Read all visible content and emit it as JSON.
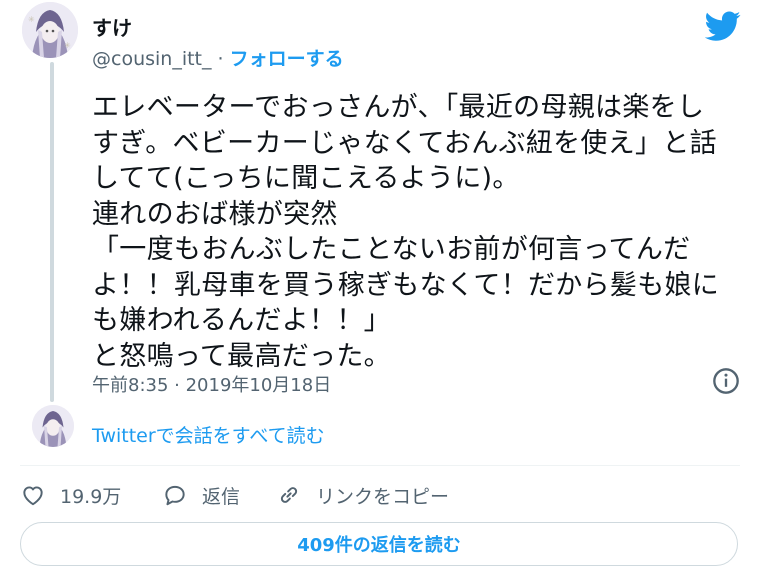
{
  "author": {
    "display_name": "すけ",
    "handle": "@cousin_itt_",
    "separator": " · ",
    "follow_label": "フォローする"
  },
  "tweet": {
    "lines": [
      "エレベーターでおっさんが、「最近の母親は楽をし",
      "すぎ。ベビーカーじゃなくておんぶ紐を使え」と話",
      "してて(こっちに聞こえるように)。",
      "連れのおば様が突然",
      "「一度もおんぶしたことないお前が何言ってんだ",
      "よ！！乳母車を買う稼ぎもなくて！だから髪も娘に",
      "も嫌われるんだよ！！」",
      "と怒鳴って最高だった。"
    ],
    "timestamp": "午前8:35 · 2019年10月18日"
  },
  "thread": {
    "read_conversation_label": "Twitterで会話をすべて読む"
  },
  "actions": {
    "like_count": "19.9万",
    "reply_label": "返信",
    "copy_link_label": "リンクをコピー"
  },
  "replies_button_label": "409件の返信を読む",
  "icons": {
    "logo": "twitter-bird-icon",
    "info": "info-icon",
    "like": "heart-icon",
    "reply": "speech-bubble-icon",
    "link": "link-icon"
  },
  "colors": {
    "accent": "#1d9bf0",
    "text": "#0f1419",
    "secondary": "#536471",
    "border": "#cfd9de"
  }
}
